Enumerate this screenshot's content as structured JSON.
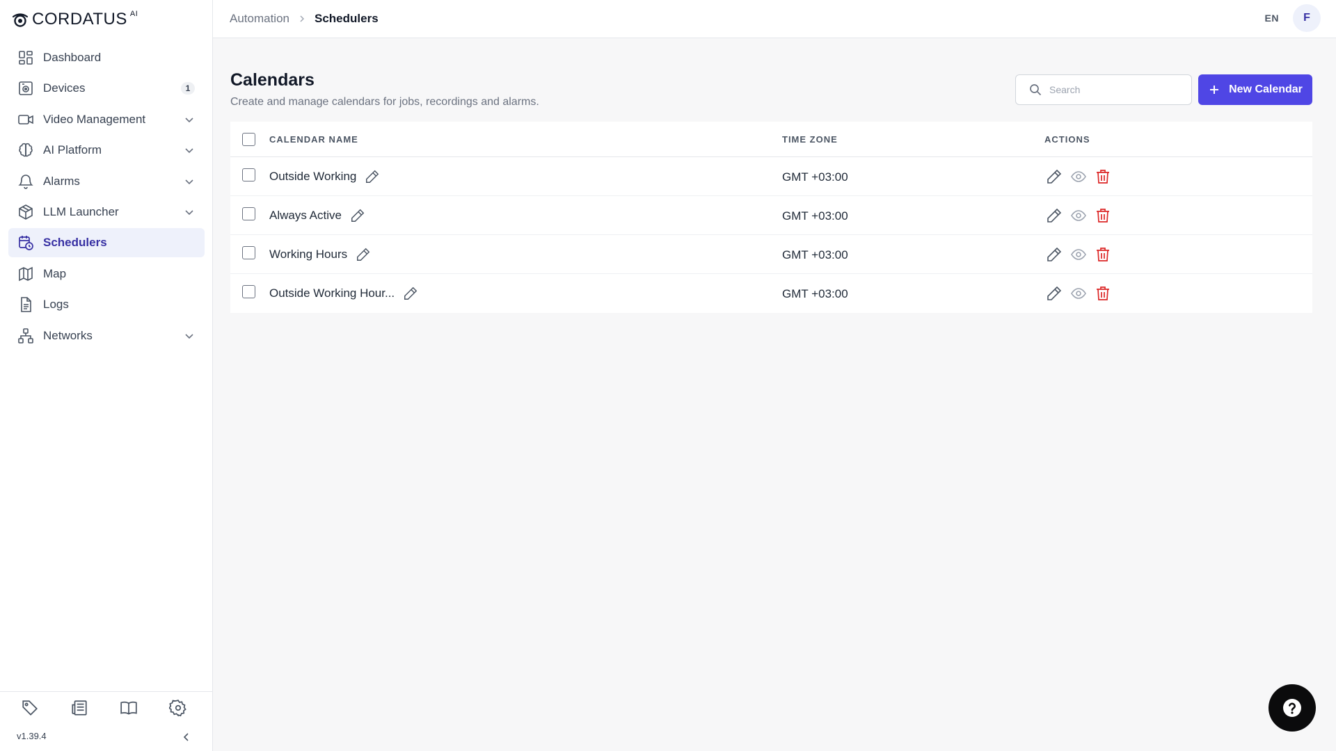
{
  "app": {
    "logo_text": "CORDATUS",
    "logo_sup": "AI"
  },
  "sidebar": {
    "items": [
      {
        "label": "Dashboard",
        "icon": "dashboard-icon"
      },
      {
        "label": "Devices",
        "icon": "devices-icon",
        "badge": "1"
      },
      {
        "label": "Video Management",
        "icon": "video-icon",
        "expandable": true
      },
      {
        "label": "AI Platform",
        "icon": "brain-icon",
        "expandable": true
      },
      {
        "label": "Alarms",
        "icon": "bell-icon",
        "expandable": true
      },
      {
        "label": "LLM Launcher",
        "icon": "cube-icon",
        "expandable": true
      },
      {
        "label": "Schedulers",
        "icon": "calendar-clock-icon",
        "active": true
      },
      {
        "label": "Map",
        "icon": "map-icon"
      },
      {
        "label": "Logs",
        "icon": "document-icon"
      },
      {
        "label": "Networks",
        "icon": "network-icon",
        "expandable": true
      }
    ],
    "footer_icons": [
      "tag-icon",
      "newspaper-icon",
      "book-icon",
      "settings-icon"
    ],
    "version": "v1.39.4"
  },
  "topbar": {
    "breadcrumb": {
      "parent": "Automation",
      "current": "Schedulers"
    },
    "language": "EN",
    "avatar_initial": "F"
  },
  "main": {
    "title": "Calendars",
    "subtitle": "Create and manage calendars for jobs, recordings and alarms.",
    "search_placeholder": "Search",
    "new_button_label": "New Calendar"
  },
  "table": {
    "columns": {
      "name": "CALENDAR NAME",
      "timezone": "TIME ZONE",
      "actions": "ACTIONS"
    },
    "rows": [
      {
        "name": "Outside Working",
        "timezone": "GMT +03:00"
      },
      {
        "name": "Always Active",
        "timezone": "GMT +03:00"
      },
      {
        "name": "Working Hours",
        "timezone": "GMT +03:00"
      },
      {
        "name": "Outside Working Hour...",
        "timezone": "GMT +03:00"
      }
    ]
  },
  "colors": {
    "accent": "#4f46e5",
    "active_bg": "#eef1fb",
    "danger": "#dc2626"
  }
}
